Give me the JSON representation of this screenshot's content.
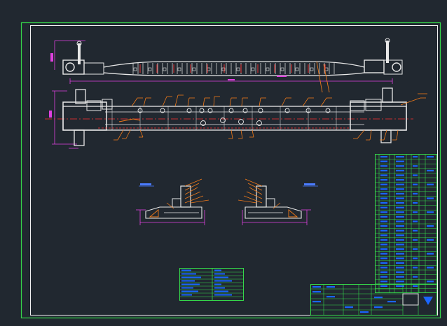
{
  "drawing": {
    "background": "#212830",
    "colors": {
      "border": "#35d84a",
      "frame": "#f2f2f2",
      "dimension": "#e040e0",
      "leader": "#f07a1a",
      "annotation_blue": "#4a7bff",
      "table_blue": "#1a66ff",
      "table_line": "#35d84a",
      "center_line": "#ff3030"
    },
    "views": [
      {
        "name": "front-elevation"
      },
      {
        "name": "plan-view"
      },
      {
        "name": "detail-section-left"
      },
      {
        "name": "detail-section-right"
      }
    ],
    "tables": [
      {
        "name": "parts-list",
        "rows": 30
      },
      {
        "name": "title-block"
      },
      {
        "name": "technical-requirements",
        "rows": 9
      }
    ]
  }
}
